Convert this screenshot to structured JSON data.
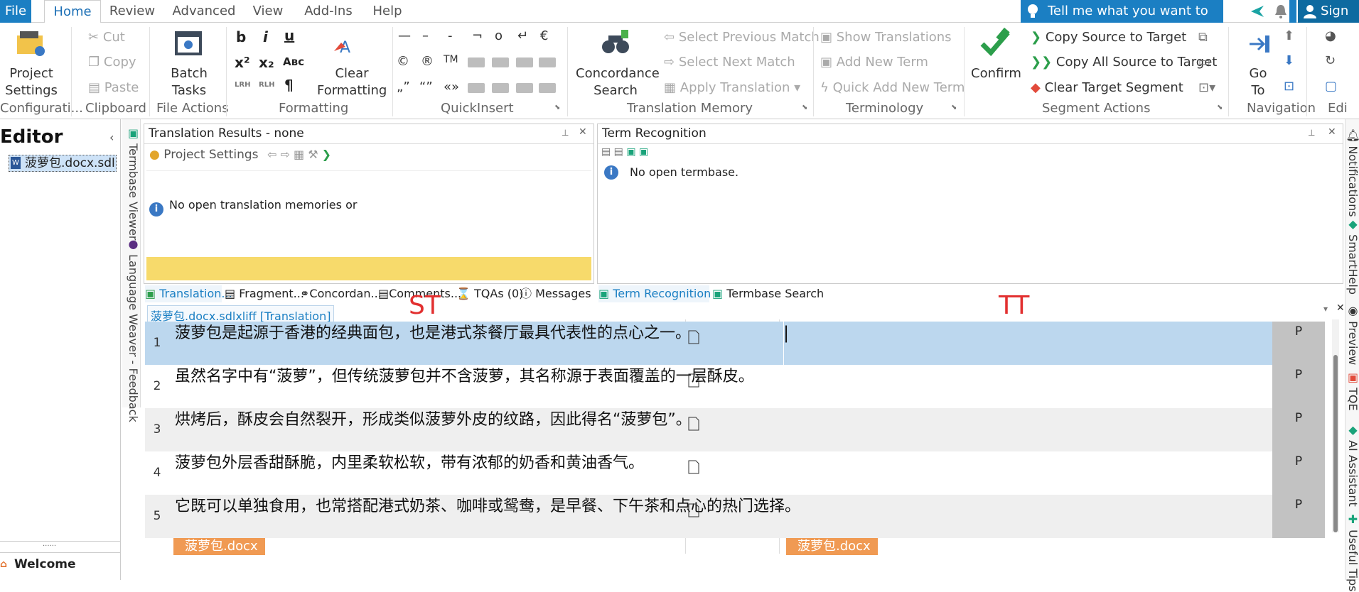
{
  "menu": {
    "file": "File",
    "tabs": [
      "Home",
      "Review",
      "Advanced",
      "View",
      "Add-Ins",
      "Help"
    ],
    "tell_me": "Tell me what you want to do...",
    "sign_in": "Sign In"
  },
  "ribbon": {
    "configuration": {
      "project_settings": "Project Settings",
      "label": "Configurati..."
    },
    "clipboard": {
      "cut": "Cut",
      "copy": "Copy",
      "paste": "Paste",
      "label": "Clipboard"
    },
    "file_actions": {
      "batch_tasks": "Batch Tasks",
      "label": "File Actions"
    },
    "formatting": {
      "clear_formatting": "Clear Formatting",
      "label": "Formatting"
    },
    "quickinsert": {
      "label": "QuickInsert"
    },
    "tm": {
      "concordance": "Concordance Search",
      "select_prev": "Select Previous Match",
      "select_next": "Select Next Match",
      "apply": "Apply Translation",
      "label": "Translation Memory"
    },
    "terminology": {
      "show": "Show Translations",
      "add": "Add New Term",
      "quick_add": "Quick Add New Term",
      "label": "Terminology"
    },
    "segment_actions": {
      "confirm": "Confirm",
      "copy_source": "Copy Source to Target",
      "copy_all": "Copy All Source to Target",
      "clear_target": "Clear Target Segment",
      "label": "Segment Actions"
    },
    "navigation": {
      "go_to": "Go To",
      "label": "Navigation"
    },
    "editing": {
      "label": "Edi"
    }
  },
  "left": {
    "title": "Editor",
    "file": "菠萝包.docx.sdl",
    "welcome": "Welcome",
    "vtabs": [
      "Termbase Viewer",
      "Language Weaver - Feedback"
    ]
  },
  "tr_panel": {
    "title": "Translation Results - none",
    "toolbar_label": "Project Settings",
    "note": "No open translation memories or"
  },
  "term_panel": {
    "title": "Term Recognition",
    "note": "No open termbase."
  },
  "panel_tabs": {
    "left": [
      "Translation...",
      "Fragment...",
      "Concordan...",
      "Comments...",
      "TQAs (0)",
      "Messages"
    ],
    "right": [
      "Term Recognition",
      "Termbase Search"
    ]
  },
  "editor": {
    "doc_tab": "菠萝包.docx.sdlxliff [Translation]",
    "st_label": "ST",
    "tt_label": "TT",
    "segments": [
      {
        "num": "1",
        "source": "菠萝包是起源于香港的经典面包，也是港式茶餐厅最具代表性的点心之一。",
        "status": "P"
      },
      {
        "num": "2",
        "source": "虽然名字中有“菠萝”，但传统菠萝包并不含菠萝，其名称源于表面覆盖的一层酥皮。",
        "status": "P"
      },
      {
        "num": "3",
        "source": "烘烤后，酥皮会自然裂开，形成类似菠萝外皮的纹路，因此得名“菠萝包”。",
        "status": "P"
      },
      {
        "num": "4",
        "source": "菠萝包外层香甜酥脆，内里柔软松软，带有浓郁的奶香和黄油香气。",
        "status": "P"
      },
      {
        "num": "5",
        "source": "它既可以单独食用，也常搭配港式奶茶、咖啡或鸳鸯，是早餐、下午茶和点心的热门选择。",
        "status": "P"
      }
    ],
    "file_tag": "菠萝包.docx"
  },
  "right_vtabs": [
    "Notifications",
    "SmartHelp",
    "Preview",
    "TQE",
    "AI Assistant",
    "Useful Tips"
  ],
  "colors": {
    "accent": "#1b7fc3",
    "selected_row": "#bcd7ee",
    "alt_row": "#efefef",
    "tag": "#f09a53",
    "yellow": "#f7da6b"
  }
}
